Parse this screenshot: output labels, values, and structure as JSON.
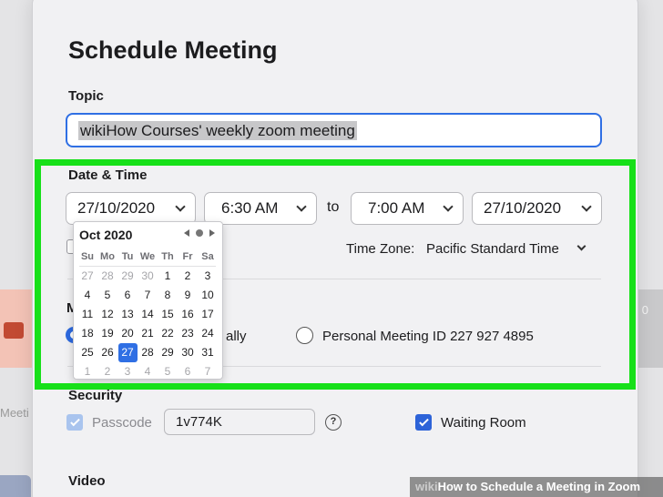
{
  "background": {
    "left_text": "Meeti",
    "right_text": "0"
  },
  "dialog": {
    "title": "Schedule Meeting",
    "topic": {
      "label": "Topic",
      "value": "wikiHow Courses' weekly zoom meeting"
    },
    "date_time": {
      "label": "Date & Time",
      "start_date": "27/10/2020",
      "start_time": "6:30 AM",
      "to_label": "to",
      "end_time": "7:00 AM",
      "end_date": "27/10/2020",
      "time_zone_label": "Time Zone:",
      "time_zone_value": "Pacific Standard Time"
    },
    "calendar": {
      "month": "Oct 2020",
      "weekdays": [
        "Su",
        "Mo",
        "Tu",
        "We",
        "Th",
        "Fr",
        "Sa"
      ],
      "days": [
        {
          "d": "27",
          "muted": true
        },
        {
          "d": "28",
          "muted": true
        },
        {
          "d": "29",
          "muted": true
        },
        {
          "d": "30",
          "muted": true
        },
        {
          "d": "1"
        },
        {
          "d": "2"
        },
        {
          "d": "3"
        },
        {
          "d": "4"
        },
        {
          "d": "5"
        },
        {
          "d": "6"
        },
        {
          "d": "7"
        },
        {
          "d": "8"
        },
        {
          "d": "9"
        },
        {
          "d": "10"
        },
        {
          "d": "11"
        },
        {
          "d": "12"
        },
        {
          "d": "13"
        },
        {
          "d": "14"
        },
        {
          "d": "15"
        },
        {
          "d": "16"
        },
        {
          "d": "17"
        },
        {
          "d": "18"
        },
        {
          "d": "19"
        },
        {
          "d": "20"
        },
        {
          "d": "21"
        },
        {
          "d": "22"
        },
        {
          "d": "23"
        },
        {
          "d": "24"
        },
        {
          "d": "25"
        },
        {
          "d": "26"
        },
        {
          "d": "27",
          "selected": true
        },
        {
          "d": "28"
        },
        {
          "d": "29"
        },
        {
          "d": "30"
        },
        {
          "d": "31"
        },
        {
          "d": "1",
          "muted": true
        },
        {
          "d": "2",
          "muted": true
        },
        {
          "d": "3",
          "muted": true
        },
        {
          "d": "4",
          "muted": true
        },
        {
          "d": "5",
          "muted": true
        },
        {
          "d": "6",
          "muted": true
        },
        {
          "d": "7",
          "muted": true
        }
      ]
    },
    "meeting_id": {
      "label_partial": "M",
      "auto_label_partial": "ally",
      "personal_label": "Personal Meeting ID 227 927 4895"
    },
    "security": {
      "label": "Security",
      "passcode_label": "Passcode",
      "passcode_value": "1v774K",
      "help_glyph": "?",
      "waiting_room_label": "Waiting Room"
    },
    "video": {
      "label": "Video"
    }
  },
  "watermark": {
    "prefix": "wiki",
    "text": "How to Schedule a Meeting in Zoom"
  },
  "colors": {
    "highlight": "#17e019",
    "accent": "#2f6fe4"
  }
}
